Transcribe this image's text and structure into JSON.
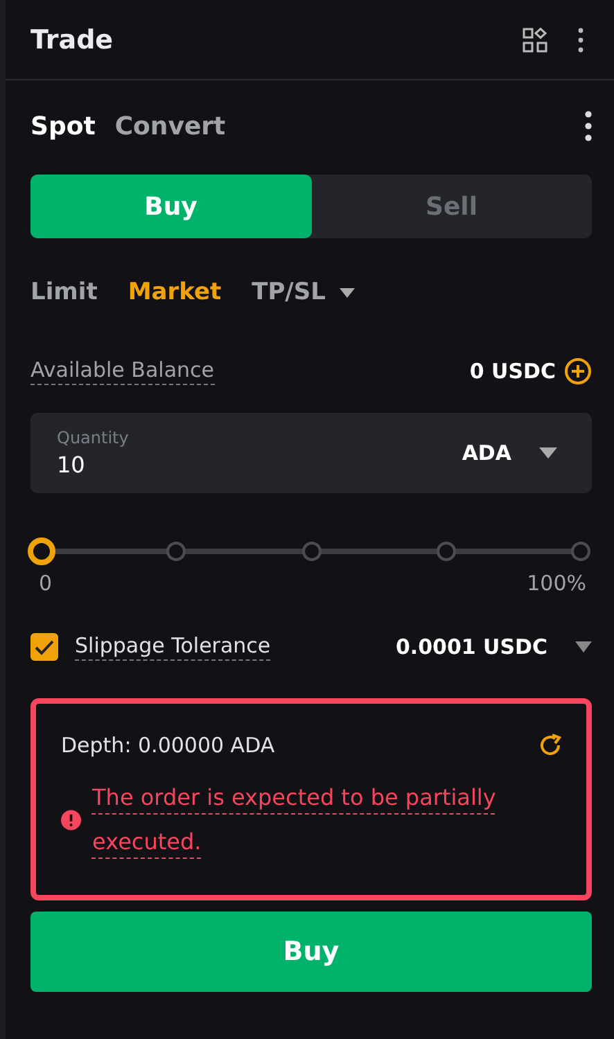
{
  "header": {
    "title": "Trade"
  },
  "mode_tabs": [
    {
      "label": "Spot",
      "selected": true
    },
    {
      "label": "Convert",
      "selected": false
    }
  ],
  "side_toggle": [
    {
      "label": "Buy",
      "selected": true
    },
    {
      "label": "Sell",
      "selected": false
    }
  ],
  "order_types": [
    {
      "label": "Limit",
      "selected": false,
      "dropdown": false
    },
    {
      "label": "Market",
      "selected": true,
      "dropdown": false
    },
    {
      "label": "TP/SL",
      "selected": false,
      "dropdown": true
    }
  ],
  "balance": {
    "label": "Available Balance",
    "value": "0 USDC"
  },
  "quantity": {
    "placeholder": "Quantity",
    "value": "10",
    "unit": "ADA"
  },
  "slider": {
    "level": 0,
    "min_label": "0",
    "max_label": "100%"
  },
  "slippage": {
    "checked": true,
    "label": "Slippage Tolerance",
    "value": "0.0001 USDC"
  },
  "depth_panel": {
    "highlighted": true,
    "depth": "Depth: 0.00000 ADA",
    "warning": "The order is expected to be partially executed."
  },
  "submit": {
    "label": "Buy"
  }
}
